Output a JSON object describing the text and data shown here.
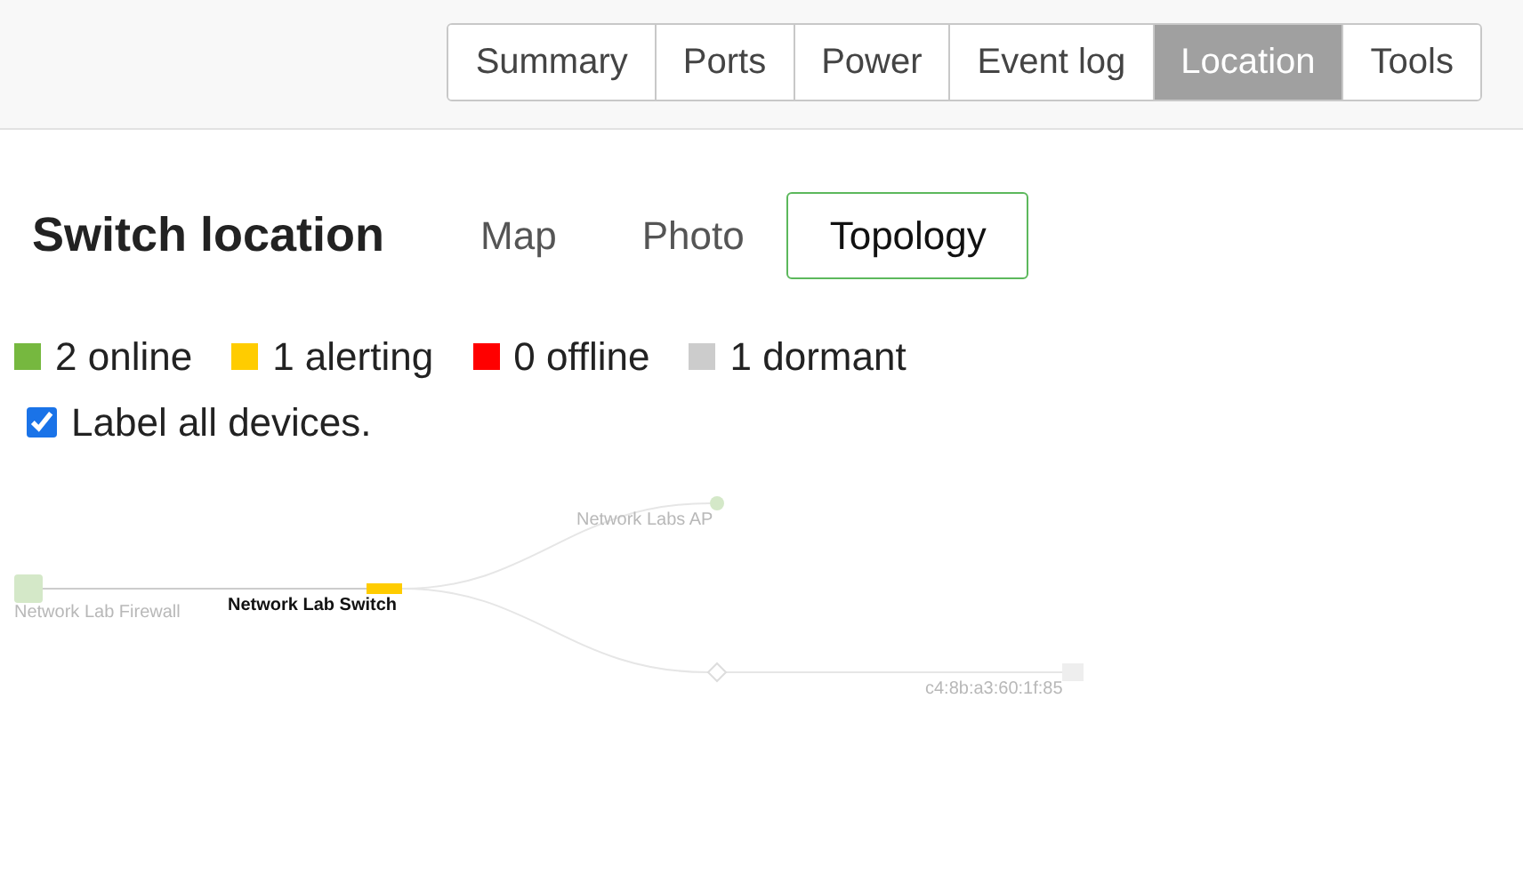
{
  "tabs": [
    {
      "label": "Summary",
      "selected": false
    },
    {
      "label": "Ports",
      "selected": false
    },
    {
      "label": "Power",
      "selected": false
    },
    {
      "label": "Event log",
      "selected": false
    },
    {
      "label": "Location",
      "selected": true
    },
    {
      "label": "Tools",
      "selected": false
    }
  ],
  "title": "Switch location",
  "views": [
    {
      "label": "Map",
      "selected": false
    },
    {
      "label": "Photo",
      "selected": false
    },
    {
      "label": "Topology",
      "selected": true
    }
  ],
  "legend": [
    {
      "label": "2 online",
      "color": "#76b83f"
    },
    {
      "label": "1 alerting",
      "color": "#ffcc00"
    },
    {
      "label": "0 offline",
      "color": "#ff0000"
    },
    {
      "label": "1 dormant",
      "color": "#cccccc"
    }
  ],
  "label_all": {
    "label": "Label all devices.",
    "checked": true
  },
  "topology": {
    "nodes": [
      {
        "kind": "firewall",
        "label": "Network Lab Firewall",
        "color": "#d4e8c8",
        "dimmed": true
      },
      {
        "kind": "switch",
        "label": "Network Lab Switch",
        "color": "#ffcc00",
        "dimmed": false
      },
      {
        "kind": "ap",
        "label": "Network Labs AP",
        "color": "#d4e8c8",
        "dimmed": true
      },
      {
        "kind": "hub",
        "color": "#ffffff"
      },
      {
        "kind": "client",
        "label": "c4:8b:a3:60:1f:85",
        "color": "#eeeeee",
        "dimmed": true
      }
    ]
  }
}
